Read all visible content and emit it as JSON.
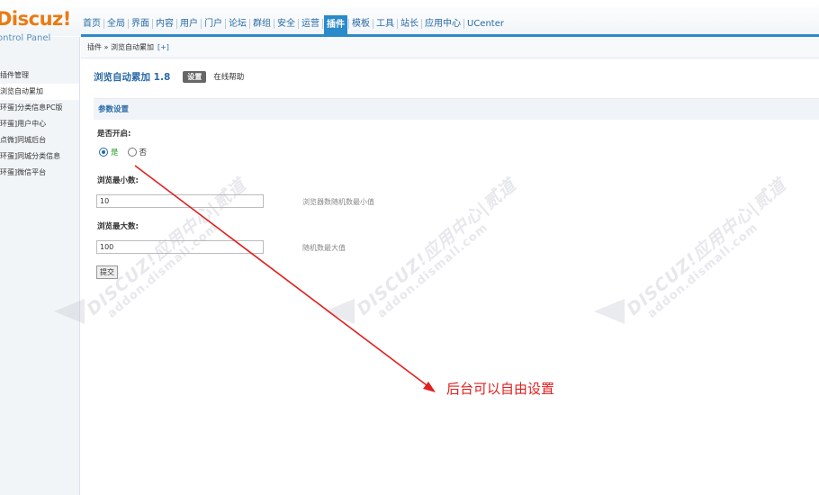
{
  "logo": {
    "brand": "Discuz",
    "exclaim": "!",
    "subtitle": "ontrol Panel"
  },
  "nav": {
    "items": [
      "首页",
      "全局",
      "界面",
      "内容",
      "用户",
      "门户",
      "论坛",
      "群组",
      "安全",
      "运营",
      "插件",
      "模板",
      "工具",
      "站长",
      "应用中心",
      "UCenter"
    ],
    "active_index": 10
  },
  "sidebar": {
    "items": [
      "插件管理",
      "浏览自动累加",
      "环蛋]分类信息PC版",
      "环蛋]用户中心",
      "点微]同城后台",
      "环蛋]同城分类信息",
      "环蛋]微信平台"
    ],
    "active_index": 1
  },
  "breadcrumb": {
    "path": "插件 » 浏览自动累加",
    "add": "[+]"
  },
  "plugin": {
    "title": "浏览自动累加 1.8",
    "settings_button": "设置",
    "help_link": "在线帮助"
  },
  "section": {
    "title": "参数设置"
  },
  "fields": {
    "enable": {
      "label": "是否开启:",
      "yes": "是",
      "no": "否",
      "selected": "是"
    },
    "min": {
      "label": "浏览最小数:",
      "value": "10",
      "desc": "浏览器数随机数最小值"
    },
    "max": {
      "label": "浏览最大数:",
      "value": "100",
      "desc": "随机数最大值"
    }
  },
  "submit_label": "提交",
  "watermark": {
    "line1": "DISCUZ!应用中心|贰道",
    "line2": "addon.dismall.com"
  },
  "annotation": {
    "text": "后台可以自由设置",
    "color": "#e02020"
  },
  "colors": {
    "accent": "#2b8ac9",
    "logo": "#ec7a10",
    "link": "#2a6aa6"
  }
}
